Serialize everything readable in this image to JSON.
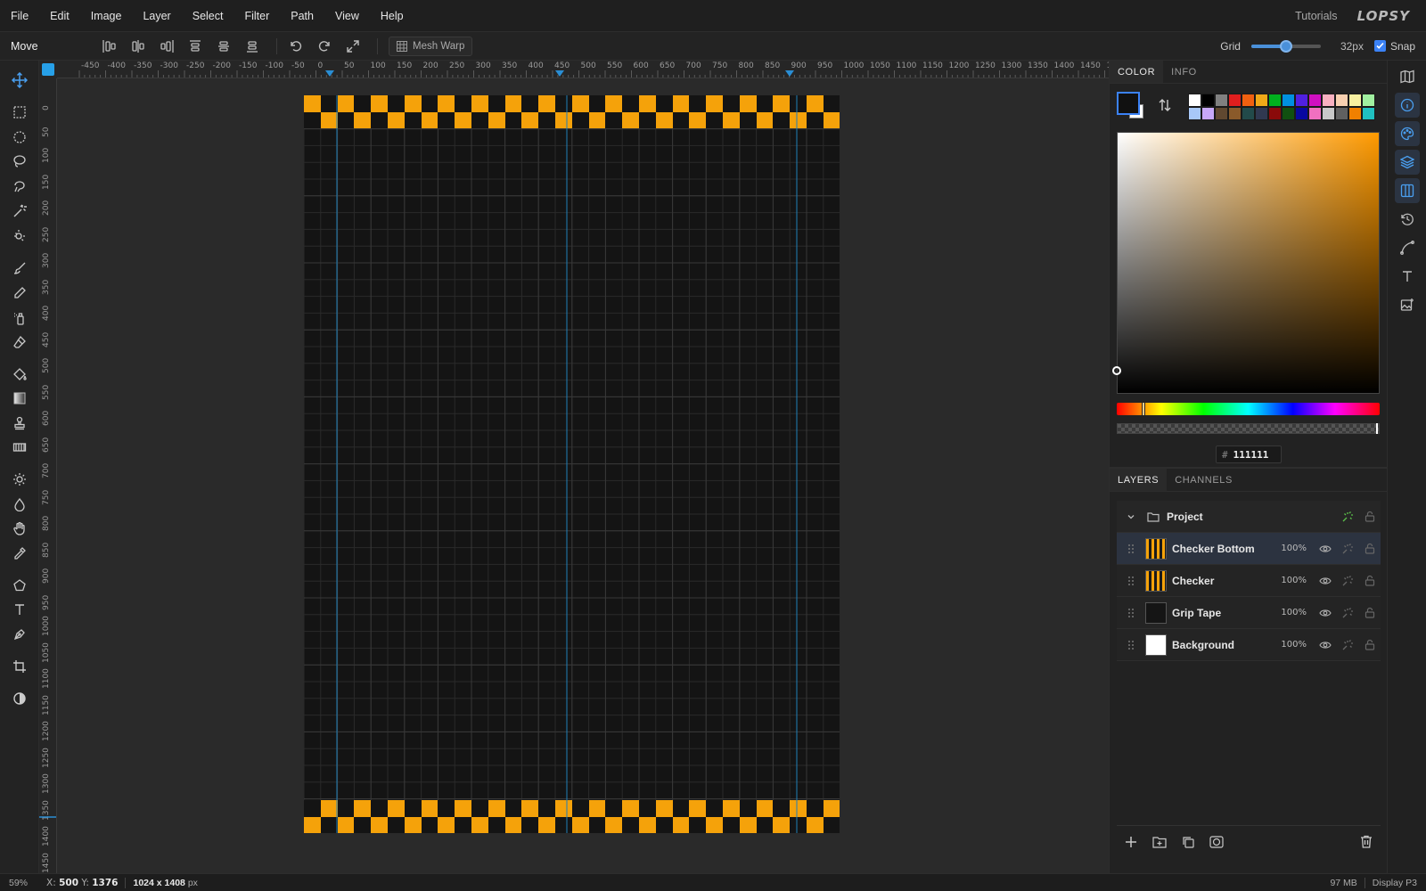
{
  "menu": [
    "File",
    "Edit",
    "Image",
    "Layer",
    "Select",
    "Filter",
    "Path",
    "View",
    "Help"
  ],
  "header": {
    "tutorials": "Tutorials",
    "logo": "LOPSY"
  },
  "options": {
    "tool_name": "Move",
    "mesh_warp": "Mesh Warp",
    "grid_label": "Grid",
    "grid_value": "32px",
    "grid_slider_fraction": 0.5,
    "snap_label": "Snap",
    "snap_checked": true
  },
  "ruler": {
    "top_labels": [
      "-450",
      "-400",
      "-350",
      "-300",
      "-250",
      "-200",
      "-150",
      "-100",
      "-50",
      "0",
      "50",
      "100",
      "150",
      "200",
      "250",
      "300",
      "350",
      "400",
      "450",
      "500",
      "550",
      "600",
      "650",
      "700",
      "750",
      "800",
      "850",
      "900",
      "950",
      "1000",
      "1050",
      "1100",
      "1150",
      "1200",
      "1250",
      "1300",
      "1350",
      "1400",
      "1450",
      "150"
    ],
    "left_labels": [
      "0",
      "50",
      "100",
      "150",
      "200",
      "250",
      "300",
      "350",
      "400",
      "450",
      "500",
      "550",
      "600",
      "650",
      "700",
      "750",
      "800",
      "850",
      "900",
      "950",
      "1000",
      "1050",
      "1100",
      "1150",
      "1200",
      "1250",
      "1300",
      "1350",
      "1400",
      "1450"
    ]
  },
  "tools": [
    "move-tool",
    "rect-select-tool",
    "ellipse-select-tool",
    "lasso-tool",
    "magnetic-lasso-tool",
    "magic-wand-tool",
    "quick-select-tool",
    "brush-tool",
    "pencil-tool",
    "spray-tool",
    "eraser-tool",
    "fill-tool",
    "gradient-tool",
    "stamp-tool",
    "pattern-tool",
    "dodge-tool",
    "blur-tool",
    "hand-tool",
    "eyedropper-tool",
    "shape-tool",
    "text-tool",
    "pen-tool",
    "crop-tool",
    "contrast-tool"
  ],
  "color_panel": {
    "tabs": [
      "COLOR",
      "INFO"
    ],
    "hex_label": "#",
    "hex_value": "111111",
    "swatches_row1": [
      "#ffffff",
      "#000000",
      "#808080",
      "#e01e1e",
      "#f06010",
      "#f0a818",
      "#00b01e",
      "#0090e0",
      "#5020e0",
      "#d010c0",
      "#f8b0c0",
      "#f8d0b0",
      "#f8f0a0",
      "#a0f0a0"
    ],
    "swatches_row2": [
      "#a8c8f8",
      "#c8a8f8",
      "#604830",
      "#8a5a2a",
      "#224a4a",
      "#303850",
      "#8a0a0a",
      "#105010",
      "#0808a0",
      "#f070c0",
      "#c8c8c8",
      "#606060",
      "#f08000",
      "#20c0c0"
    ],
    "hue_fraction": 0.1,
    "alpha_fraction": 1.0
  },
  "layers_panel": {
    "tabs": [
      "LAYERS",
      "CHANNELS"
    ],
    "group": {
      "name": "Project"
    },
    "layers": [
      {
        "name": "Checker Bottom",
        "opacity": "100%",
        "selected": true
      },
      {
        "name": "Checker",
        "opacity": "100%",
        "selected": false
      },
      {
        "name": "Grip Tape",
        "opacity": "100%",
        "selected": false
      },
      {
        "name": "Background",
        "opacity": "100%",
        "selected": false
      }
    ]
  },
  "rail": [
    "map-icon",
    "info-icon",
    "palette-icon",
    "layers-icon",
    "channels-icon",
    "history-icon",
    "path-icon",
    "text-icon",
    "image-icon"
  ],
  "status": {
    "zoom": "59%",
    "x_label": "X:",
    "x_value": "500",
    "y_label": "Y:",
    "y_value": "1376",
    "dims": "1024 x 1408",
    "dims_unit": "px",
    "memory": "97 MB",
    "color_profile": "Display P3"
  },
  "colors": {
    "accent": "#3b82f6",
    "checker_orange": "#f5a20a",
    "checker_dark": "#141414",
    "guide": "#1f7fb8"
  }
}
